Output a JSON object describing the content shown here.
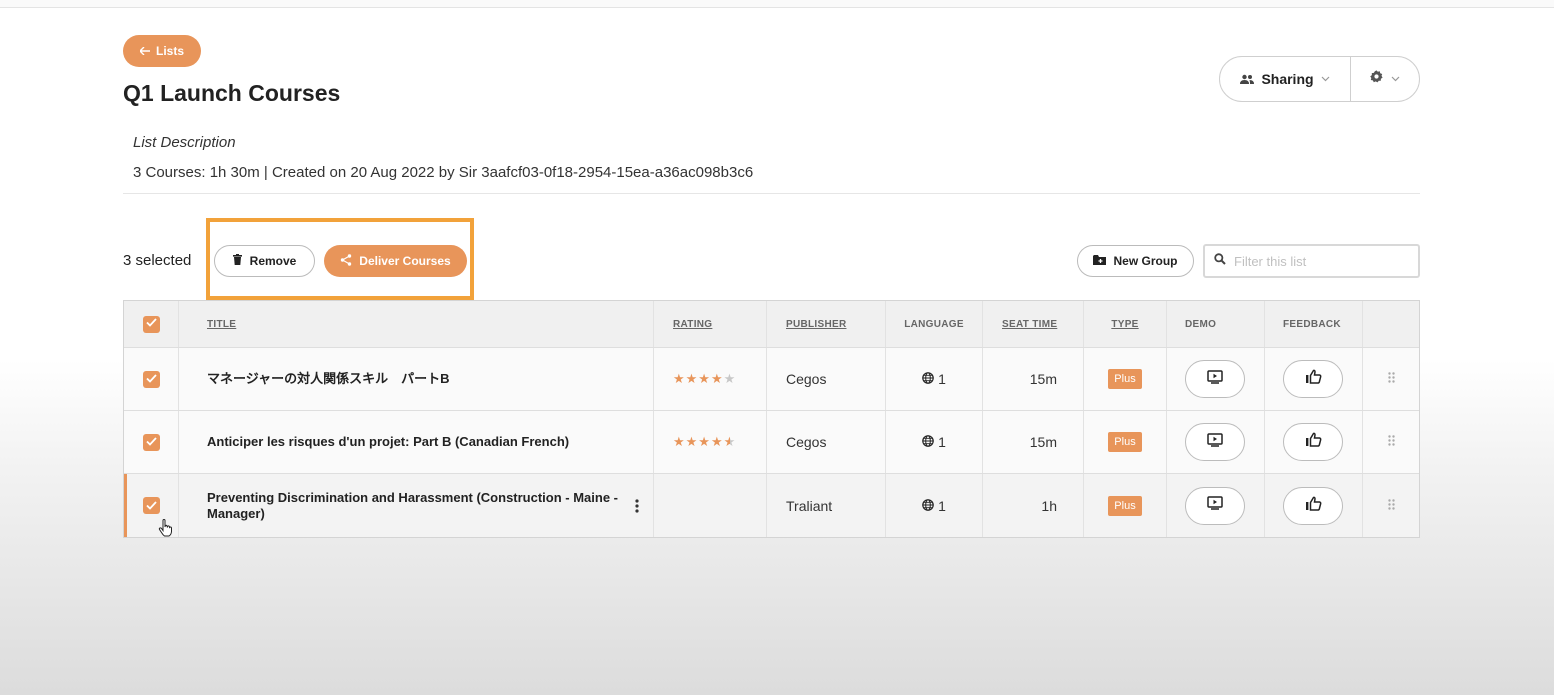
{
  "nav": {
    "back_label": "Lists"
  },
  "list": {
    "title": "Q1 Launch Courses",
    "description_label": "List Description",
    "meta": "3 Courses: 1h 30m | Created on 20 Aug 2022 by Sir 3aafcf03-0f18-2954-15ea-a36ac098b3c6"
  },
  "header_actions": {
    "sharing_label": "Sharing"
  },
  "toolbar": {
    "selected_count": "3 selected",
    "remove_label": "Remove",
    "deliver_label": "Deliver Courses",
    "new_group_label": "New Group",
    "filter_placeholder": "Filter this list"
  },
  "table": {
    "columns": [
      "TITLE",
      "RATING",
      "PUBLISHER",
      "LANGUAGE",
      "SEAT TIME",
      "TYPE",
      "DEMO",
      "FEEDBACK"
    ],
    "rows": [
      {
        "title": "マネージャーの対人関係スキル　パートB",
        "rating": 4,
        "publisher": "Cegos",
        "language_count": "1",
        "seat_time": "15m",
        "type": "Plus"
      },
      {
        "title": "Anticiper les risques d'un projet: Part B (Canadian French)",
        "rating": 4.5,
        "publisher": "Cegos",
        "language_count": "1",
        "seat_time": "15m",
        "type": "Plus"
      },
      {
        "title": "Preventing Discrimination and Harassment (Construction - Maine - Manager)",
        "rating": null,
        "publisher": "Traliant",
        "language_count": "1",
        "seat_time": "1h",
        "type": "Plus"
      }
    ]
  },
  "colors": {
    "accent": "#e8955a",
    "highlight_outline": "#f2a23a"
  },
  "icons": [
    "arrow-left-icon",
    "people-icon",
    "chevron-down-icon",
    "gear-icon",
    "trash-icon",
    "share-icon",
    "folder-plus-icon",
    "search-icon",
    "check-icon",
    "star-icon",
    "globe-icon",
    "play-icon",
    "thumbs-up-icon",
    "drag-handle-icon",
    "kebab-icon",
    "hand-cursor-icon"
  ]
}
